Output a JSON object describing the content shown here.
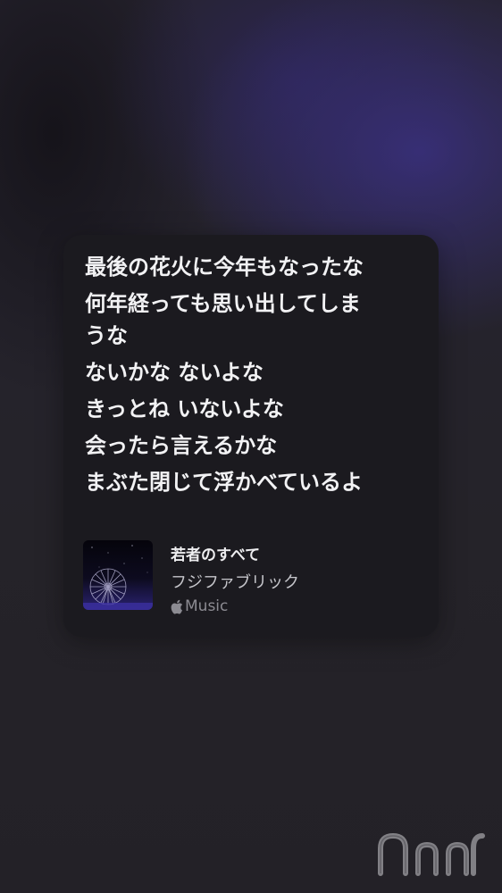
{
  "lyrics": [
    "最後の花火に今年もなったな",
    "何年経っても思い出してしま",
    "うな",
    "ないかな ないよな",
    "きっとね いないよな",
    "会ったら言えるかな",
    "まぶた閉じて浮かべているよ"
  ],
  "track": {
    "title": "若者のすべて",
    "artist": "フジファブリック",
    "service": "Music",
    "service_icon": "apple-logo-icon"
  },
  "watermark": {
    "icon": "watermark-logo-icon"
  },
  "colors": {
    "card_background": "#1b1a1f",
    "lyric_text": "#f2f2f4",
    "secondary_text": "#c6c6cb",
    "service_text": "#8c8b92",
    "background_glow": "#3a3080"
  }
}
